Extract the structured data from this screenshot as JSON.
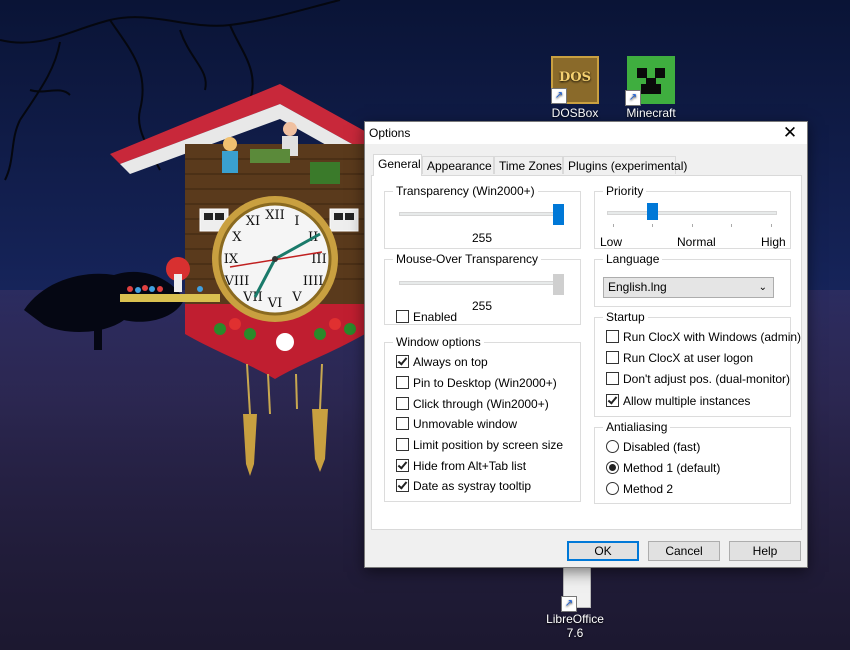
{
  "desktop": {
    "icons": [
      {
        "label": "DOSBox",
        "glyph": "DOS"
      },
      {
        "label": "Minecraft",
        "glyph": ""
      },
      {
        "label_line1": "LibreOffice",
        "label_line2": "7.6"
      }
    ]
  },
  "dialog": {
    "title": "Options",
    "close_glyph": "✕",
    "tabs": [
      "General",
      "Appearance",
      "Time Zones",
      "Plugins (experimental)"
    ],
    "active_tab": "General",
    "transparency": {
      "legend": "Transparency (Win2000+)",
      "value": "255",
      "level": 1.0
    },
    "mouseover": {
      "legend": "Mouse-Over Transparency",
      "value": "255",
      "level": 1.0,
      "enabled_label": "Enabled",
      "enabled": false
    },
    "window_options": {
      "legend": "Window options",
      "items": [
        {
          "label": "Always on top",
          "checked": true
        },
        {
          "label": "Pin to Desktop (Win2000+)",
          "checked": false
        },
        {
          "label": "Click through (Win2000+)",
          "checked": false
        },
        {
          "label": "Unmovable window",
          "checked": false
        },
        {
          "label": "Limit position by screen size",
          "checked": false
        },
        {
          "label": "Hide from Alt+Tab list",
          "checked": true
        },
        {
          "label": "Date as systray tooltip",
          "checked": true
        }
      ]
    },
    "priority": {
      "legend": "Priority",
      "low": "Low",
      "normal": "Normal",
      "high": "High",
      "level": 0.25
    },
    "language": {
      "legend": "Language",
      "selected": "English.lng"
    },
    "startup": {
      "legend": "Startup",
      "items": [
        {
          "label": "Run ClocX with Windows (admin)",
          "checked": false
        },
        {
          "label": "Run ClocX at user logon",
          "checked": false
        },
        {
          "label": "Don't adjust pos. (dual-monitor)",
          "checked": false
        },
        {
          "label": "Allow multiple instances",
          "checked": true
        }
      ]
    },
    "antialiasing": {
      "legend": "Antialiasing",
      "options": [
        {
          "label": "Disabled (fast)",
          "selected": false
        },
        {
          "label": "Method 1 (default)",
          "selected": true
        },
        {
          "label": "Method 2",
          "selected": false
        }
      ]
    },
    "buttons": {
      "ok": "OK",
      "cancel": "Cancel",
      "help": "Help"
    }
  },
  "clock": {
    "numerals": [
      "XII",
      "I",
      "II",
      "III",
      "IIII",
      "V",
      "VI",
      "VII",
      "VIII",
      "IX",
      "X",
      "XI"
    ]
  }
}
